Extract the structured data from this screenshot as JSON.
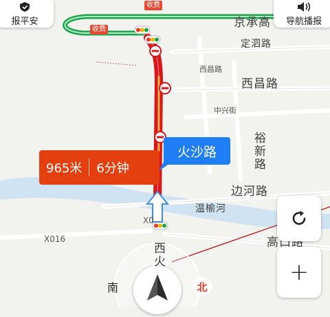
{
  "top_left": {
    "label": "报平安",
    "icon": "shield-icon"
  },
  "top_right": {
    "label": "导航播报",
    "icon": "speaker-icon"
  },
  "toll_badges": [
    "收费",
    "收费"
  ],
  "roads": {
    "jingcheng": "京承高",
    "dingsi": "定泗路",
    "xichang_small": "西昌路",
    "xichang_big": "西昌路",
    "zhongxing": "中兴街",
    "yuxin": [
      "裕",
      "新",
      "路"
    ],
    "bianhe": "边河路",
    "wenyu": "温榆河",
    "gaoko": "高口路",
    "x016": "X016",
    "x01_cut": "X0",
    "xi_vert": [
      "西",
      "火"
    ]
  },
  "eta": {
    "distance": "965米",
    "time": "6分钟"
  },
  "current_road": "火沙路",
  "compass": {
    "south": "南",
    "north": "北"
  },
  "controls": {
    "refresh_icon": "refresh-icon",
    "zoom_in_icon": "plus-icon",
    "zoom_in_label": "+"
  },
  "colors": {
    "route_congested": "#d9171b",
    "route_slow": "#f6a623",
    "route_green": "#1aa64a",
    "river": "#cfe3f3",
    "accent_blue": "#1f7ef5",
    "eta_orange": "#e43f0f"
  }
}
